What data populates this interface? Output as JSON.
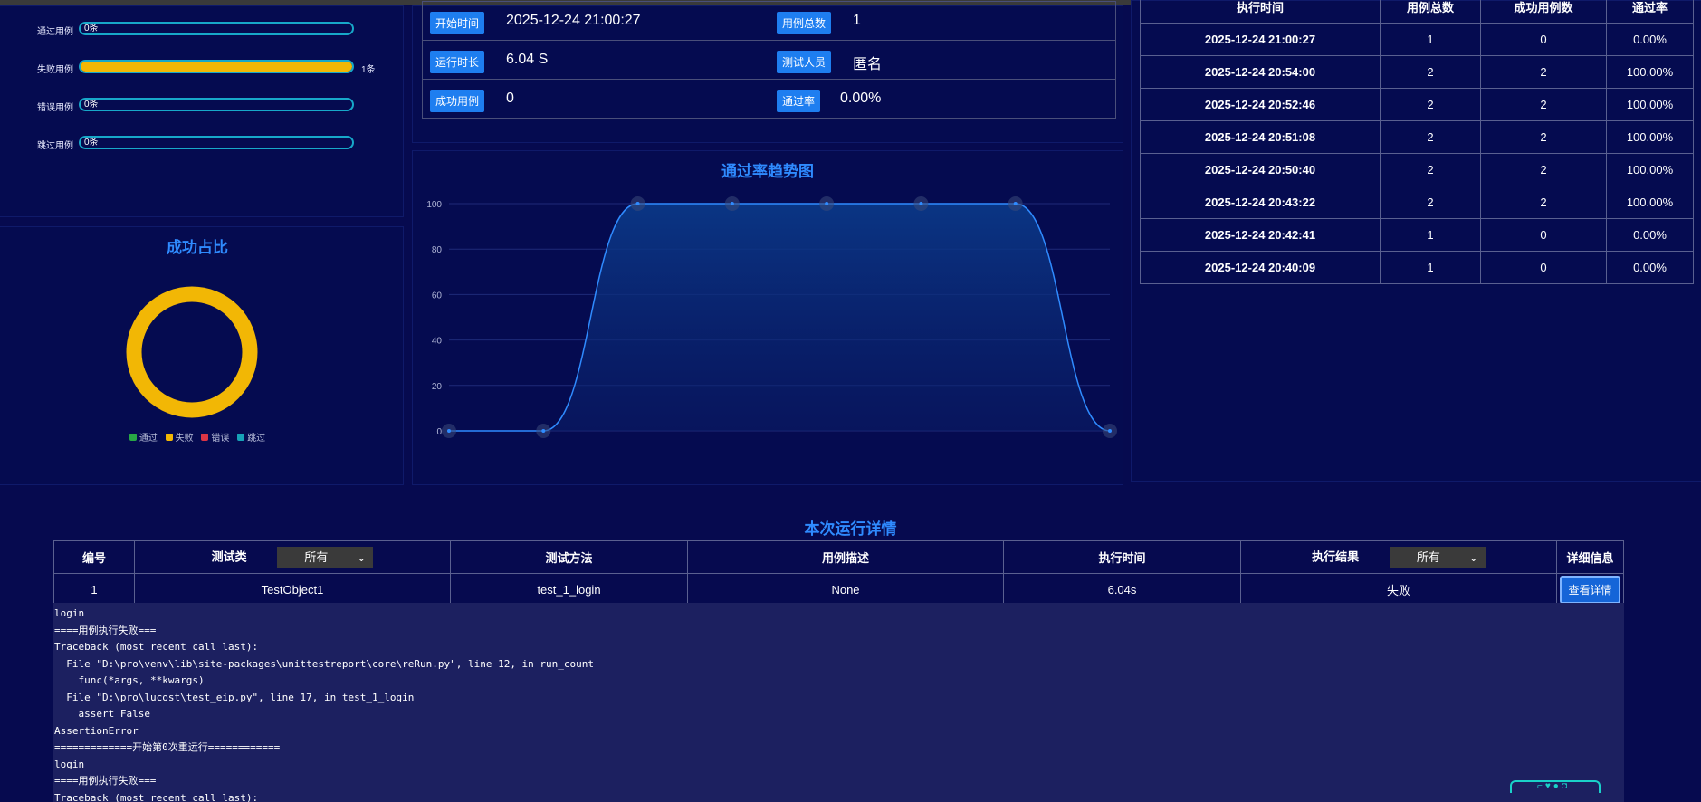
{
  "stats": [
    {
      "label": "通过用例",
      "bar_text": "0条",
      "fill": 0,
      "after": ""
    },
    {
      "label": "失败用例",
      "bar_text": "",
      "fill": 1,
      "after": "1条"
    },
    {
      "label": "错误用例",
      "bar_text": "0条",
      "fill": 0,
      "after": ""
    },
    {
      "label": "跳过用例",
      "bar_text": "0条",
      "fill": 0,
      "after": ""
    }
  ],
  "pie": {
    "title": "成功占比",
    "legend": [
      {
        "label": "通过",
        "color": "#28a745"
      },
      {
        "label": "失败",
        "color": "#f2b705"
      },
      {
        "label": "错误",
        "color": "#dc3545"
      },
      {
        "label": "跳过",
        "color": "#17a2b8"
      }
    ]
  },
  "info": {
    "start_time_label": "开始时间",
    "start_time": "2025-12-24 21:00:27",
    "total_label": "用例总数",
    "total": "1",
    "duration_label": "运行时长",
    "duration": "6.04 S",
    "tester_label": "测试人员",
    "tester": "匿名",
    "success_label": "成功用例",
    "success": "0",
    "pass_rate_label": "通过率",
    "pass_rate": "0.00%"
  },
  "trend": {
    "title": "通过率趋势图"
  },
  "chart_data": {
    "type": "area",
    "title": "通过率趋势图",
    "x": [
      1,
      2,
      3,
      4,
      5,
      6,
      7,
      8
    ],
    "values": [
      0,
      0,
      100,
      100,
      100,
      100,
      100,
      0
    ],
    "ylim": [
      0,
      100
    ],
    "yticks": [
      0,
      20,
      40,
      60,
      80,
      100
    ],
    "grid": true
  },
  "history": {
    "headers": [
      "执行时间",
      "用例总数",
      "成功用例数",
      "通过率"
    ],
    "rows": [
      [
        "2025-12-24 21:00:27",
        "1",
        "0",
        "0.00%"
      ],
      [
        "2025-12-24 20:54:00",
        "2",
        "2",
        "100.00%"
      ],
      [
        "2025-12-24 20:52:46",
        "2",
        "2",
        "100.00%"
      ],
      [
        "2025-12-24 20:51:08",
        "2",
        "2",
        "100.00%"
      ],
      [
        "2025-12-24 20:50:40",
        "2",
        "2",
        "100.00%"
      ],
      [
        "2025-12-24 20:43:22",
        "2",
        "2",
        "100.00%"
      ],
      [
        "2025-12-24 20:42:41",
        "1",
        "0",
        "0.00%"
      ],
      [
        "2025-12-24 20:40:09",
        "1",
        "0",
        "0.00%"
      ]
    ]
  },
  "details": {
    "title": "本次运行详情",
    "headers": {
      "id": "编号",
      "class": "测试类",
      "class_filter": "所有",
      "method": "测试方法",
      "desc": "用例描述",
      "time": "执行时间",
      "result": "执行结果",
      "result_filter": "所有",
      "info": "详细信息"
    },
    "row": {
      "id": "1",
      "class": "TestObject1",
      "method": "test_1_login",
      "desc": "None",
      "time": "6.04s",
      "result": "失败",
      "button": "查看详情"
    },
    "log": "login\n====用例执行失败===\nTraceback (most recent call last):\n  File \"D:\\pro\\venv\\lib\\site-packages\\unittestreport\\core\\reRun.py\", line 12, in run_count\n    func(*args, **kwargs)\n  File \"D:\\pro\\lucost\\test_eip.py\", line 17, in test_1_login\n    assert False\nAssertionError\n=============开始第0次重运行============\nlogin\n====用例执行失败===\nTraceback (most recent call last):"
  },
  "colors": {
    "accent": "#2f8bff",
    "fail": "#f2b705",
    "bar_border": "#17a8c9",
    "badge": "#1e7ef0"
  }
}
